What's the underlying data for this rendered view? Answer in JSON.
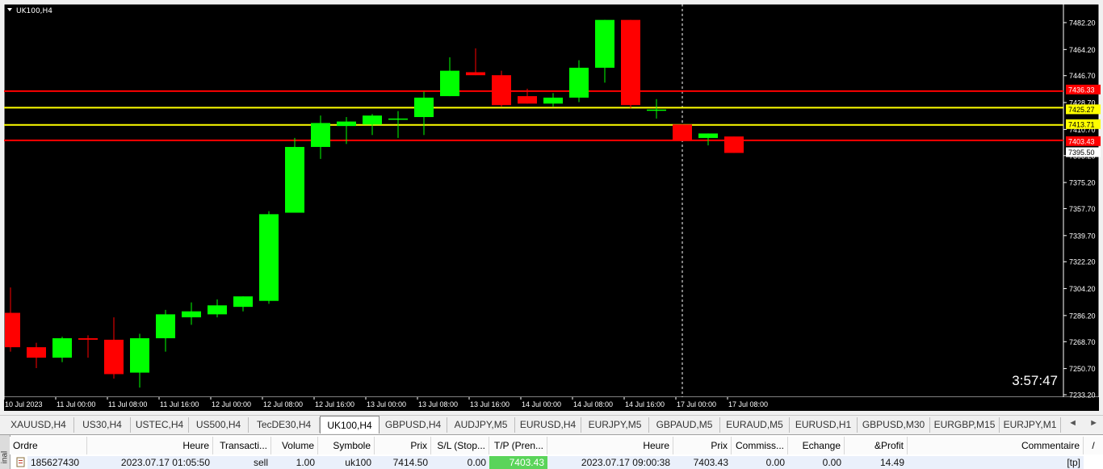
{
  "chart": {
    "title": "UK100,H4",
    "timer": "3:57:47",
    "price_axis_ticks": [
      "7482.20",
      "7464.20",
      "7446.70",
      "7428.70",
      "7410.70",
      "7393.20",
      "7375.20",
      "7357.70",
      "7339.70",
      "7322.20",
      "7304.20",
      "7286.20",
      "7268.70",
      "7250.70",
      "7233.20"
    ],
    "time_axis_ticks": [
      "10 Jul 2023",
      "11 Jul 00:00",
      "11 Jul 08:00",
      "11 Jul 16:00",
      "12 Jul 00:00",
      "12 Jul 08:00",
      "12 Jul 16:00",
      "13 Jul 00:00",
      "13 Jul 08:00",
      "13 Jul 16:00",
      "14 Jul 00:00",
      "14 Jul 08:00",
      "14 Jul 16:00",
      "17 Jul 00:00",
      "17 Jul 08:00"
    ],
    "horizontal_lines": [
      {
        "price": 7436.33,
        "label": "7436.33",
        "color": "#ff0000",
        "label_bg": "#ff0000",
        "label_fg": "#ffffff"
      },
      {
        "price": 7425.27,
        "label": "7425.27",
        "color": "#ffff00",
        "label_bg": "#ffff00",
        "label_fg": "#000000"
      },
      {
        "price": 7413.71,
        "label": "7413.71",
        "color": "#ffff00",
        "label_bg": "#ffff00",
        "label_fg": "#000000"
      },
      {
        "price": 7403.43,
        "label": "7403.43",
        "color": "#ff0000",
        "label_bg": "#ff0000",
        "label_fg": "#ffffff"
      }
    ],
    "current_price_label": {
      "price": 7395.5,
      "label": "7395.50"
    },
    "vertical_marker_index": 26,
    "colors": {
      "bull": "#00ff00",
      "bear": "#ff0000",
      "background": "#000000",
      "axis_text": "#ffffff"
    }
  },
  "chart_data": {
    "type": "candlestick",
    "title": "UK100,H4",
    "xlabel": "",
    "ylabel": "",
    "ylim": [
      7233.2,
      7490.0
    ],
    "grid": false,
    "ohlc": [
      [
        7288,
        7305,
        7262,
        7265
      ],
      [
        7265,
        7268,
        7251,
        7258
      ],
      [
        7258,
        7272,
        7255,
        7271
      ],
      [
        7271,
        7273,
        7258,
        7270
      ],
      [
        7270,
        7285,
        7244,
        7247
      ],
      [
        7248,
        7274,
        7238,
        7271
      ],
      [
        7271,
        7290,
        7262,
        7287
      ],
      [
        7285,
        7295,
        7280,
        7289
      ],
      [
        7287,
        7297,
        7285,
        7293
      ],
      [
        7292,
        7299,
        7289,
        7299
      ],
      [
        7296,
        7356,
        7294,
        7354
      ],
      [
        7355,
        7405,
        7355,
        7399
      ],
      [
        7399,
        7420,
        7391,
        7415
      ],
      [
        7413,
        7419,
        7401,
        7416
      ],
      [
        7414,
        7421,
        7407,
        7420
      ],
      [
        7418,
        7423,
        7405,
        7418
      ],
      [
        7419,
        7436,
        7407,
        7432
      ],
      [
        7433,
        7459,
        7433,
        7450
      ],
      [
        7449,
        7465,
        7447,
        7447
      ],
      [
        7447,
        7450,
        7426,
        7427
      ],
      [
        7433,
        7438,
        7428,
        7428
      ],
      [
        7428,
        7435,
        7426,
        7432
      ],
      [
        7432,
        7457,
        7429,
        7452
      ],
      [
        7452,
        7484,
        7442,
        7484
      ],
      [
        7484,
        7484,
        7425,
        7427
      ],
      [
        7424,
        7431,
        7418,
        7424
      ],
      [
        7414,
        7414,
        7403,
        7403
      ],
      [
        7405,
        7408,
        7400,
        7408
      ],
      [
        7406,
        7406,
        7395,
        7395
      ]
    ]
  },
  "tabs": {
    "items": [
      "XAUUSD,H4",
      "US30,H4",
      "USTEC,H4",
      "US500,H4",
      "TecDE30,H4",
      "UK100,H4",
      "GBPUSD,H4",
      "AUDJPY,M5",
      "EURUSD,H4",
      "EURJPY,M5",
      "GBPAUD,M5",
      "EURAUD,M5",
      "EURUSD,H1",
      "GBPUSD,M30",
      "EURGBP,M15",
      "EURJPY,M1"
    ],
    "active": "UK100,H4",
    "arrow_left": "◄",
    "arrow_right": "►"
  },
  "terminal": {
    "side_label": "inal",
    "headers": [
      "Ordre",
      "Heure",
      "Transacti...",
      "Volume",
      "Symbole",
      "Prix",
      "S/L (Stop...",
      "T/P (Pren...",
      "Heure",
      "Prix",
      "Commiss...",
      "Echange",
      "&Profit",
      "Commentaire"
    ],
    "sort_indicator": "/",
    "row": [
      "185627430",
      "2023.07.17 01:05:50",
      "sell",
      "1.00",
      "uk100",
      "7414.50",
      "0.00",
      "7403.43",
      "2023.07.17 09:00:38",
      "7403.43",
      "0.00",
      "0.00",
      "14.49",
      "[tp]"
    ],
    "tp_highlight": "#5ad45a"
  }
}
